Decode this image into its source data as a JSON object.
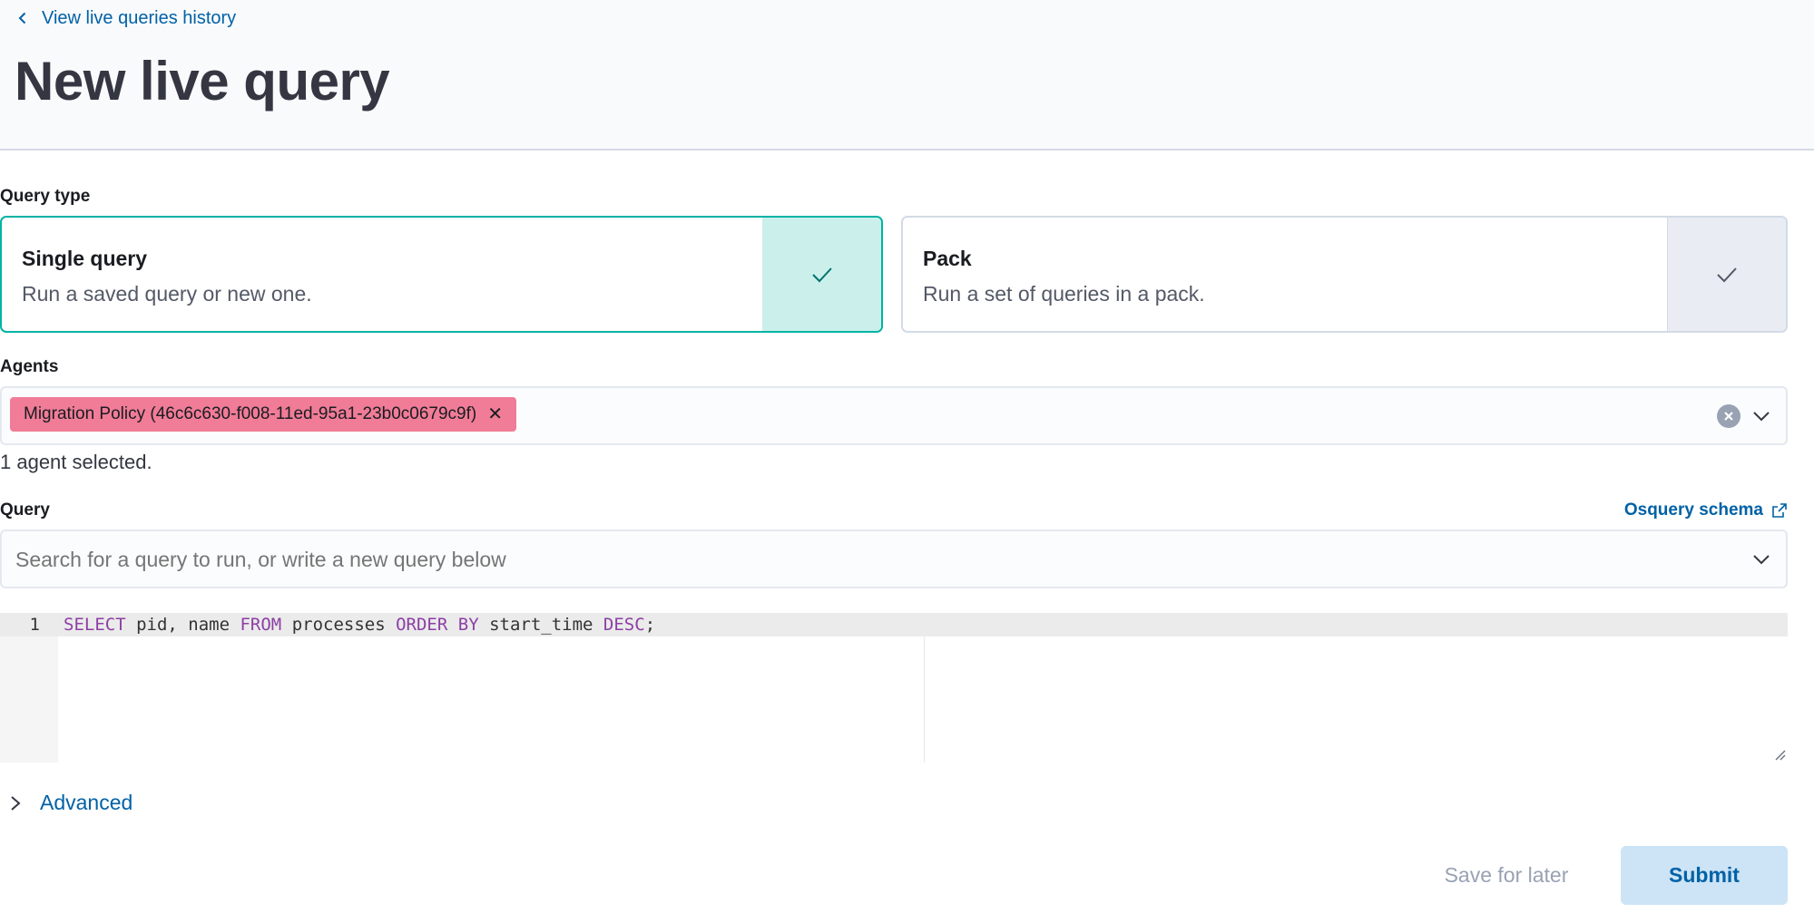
{
  "header": {
    "back_link_label": "View live queries history",
    "title": "New live query"
  },
  "query_type": {
    "label": "Query type",
    "options": [
      {
        "title": "Single query",
        "description": "Run a saved query or new one.",
        "selected": true
      },
      {
        "title": "Pack",
        "description": "Run a set of queries in a pack.",
        "selected": false
      }
    ]
  },
  "agents": {
    "label": "Agents",
    "selected_chips": [
      "Migration Policy (46c6c630-f008-11ed-95a1-23b0c0679c9f)"
    ],
    "chip_color": "#f07c97",
    "help_text": "1 agent selected."
  },
  "query": {
    "label": "Query",
    "schema_link_label": "Osquery schema",
    "search_placeholder": "Search for a query to run, or write a new query below"
  },
  "editor": {
    "line_number": "1",
    "tokens": [
      {
        "text": "SELECT",
        "type": "keyword"
      },
      {
        "text": " pid, name ",
        "type": "plain"
      },
      {
        "text": "FROM",
        "type": "keyword"
      },
      {
        "text": " processes ",
        "type": "plain"
      },
      {
        "text": "ORDER",
        "type": "keyword"
      },
      {
        "text": " ",
        "type": "plain"
      },
      {
        "text": "BY",
        "type": "keyword"
      },
      {
        "text": " start_time ",
        "type": "plain"
      },
      {
        "text": "DESC",
        "type": "keyword"
      },
      {
        "text": ";",
        "type": "plain"
      }
    ]
  },
  "advanced_label": "Advanced",
  "actions": {
    "save_label": "Save for later",
    "submit_label": "Submit"
  },
  "colors": {
    "accent": "#0061a6",
    "selected_border": "#00b3a4",
    "keyword": "#8c3fa4"
  }
}
